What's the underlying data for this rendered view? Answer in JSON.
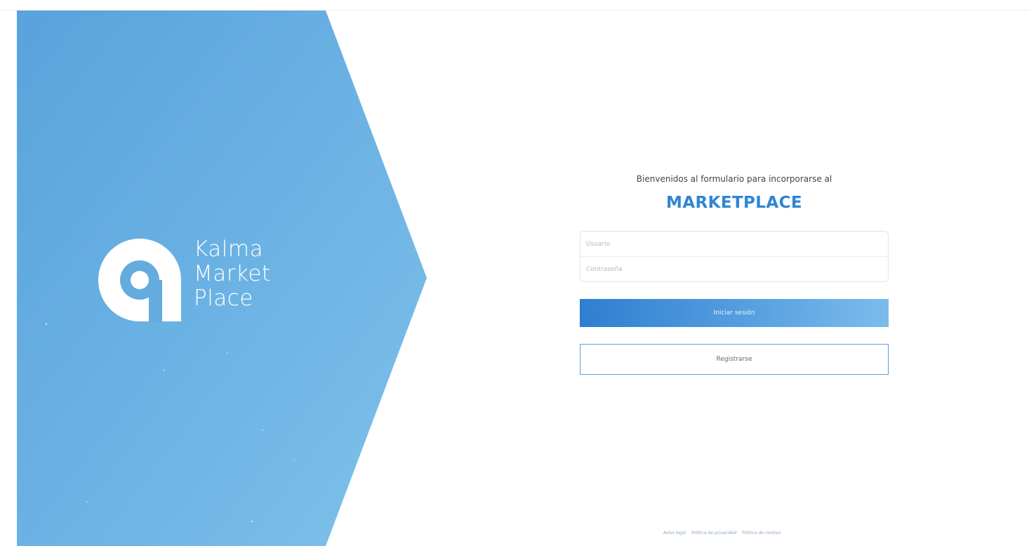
{
  "brand": {
    "line1": "Kalma",
    "line2": "Market",
    "line3": "Place",
    "logo_icon": "kalma-a-logo-icon"
  },
  "form": {
    "welcome_text": "Bienvenidos al formulario para incorporarse al",
    "title": "MARKETPLACE",
    "username_placeholder": "Usuario",
    "password_placeholder": "Contraseña",
    "login_button": "Iniciar sesión",
    "register_button": "Registrarse"
  },
  "footer": {
    "links": [
      "Aviso legal",
      "Política de privacidad",
      "Política de cookies"
    ]
  },
  "colors": {
    "accent": "#2f86d3",
    "panel_start": "#5aa6de",
    "panel_end": "#7cc0ea"
  }
}
